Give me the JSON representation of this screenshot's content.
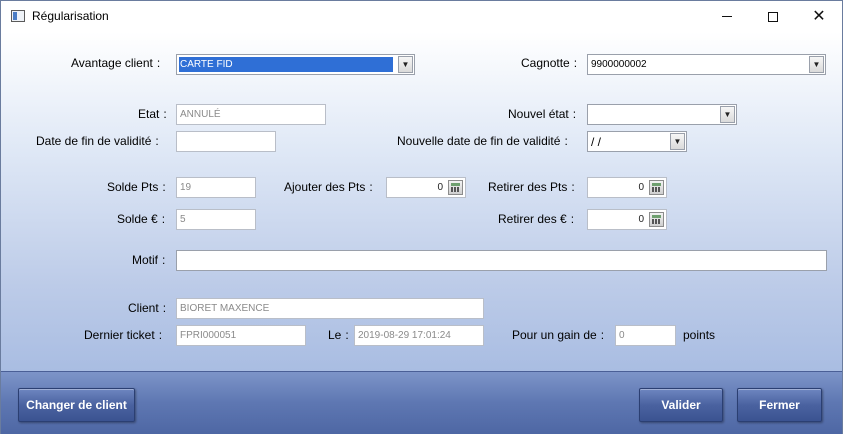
{
  "window": {
    "title": "Régularisation"
  },
  "labels": {
    "avantage": "Avantage client",
    "cagnotte": "Cagnotte",
    "etat": "Etat",
    "nouvel_etat": "Nouvel état",
    "date_fin": "Date de fin de validité",
    "nouvelle_date_fin": "Nouvelle date de fin de validité",
    "solde_pts": "Solde Pts",
    "ajouter_pts": "Ajouter des Pts",
    "retirer_pts": "Retirer des Pts",
    "solde_eur": "Solde €",
    "retirer_eur": "Retirer des €",
    "motif": "Motif",
    "client": "Client",
    "dernier_ticket": "Dernier ticket",
    "le": "Le",
    "gain": "Pour un gain de",
    "points": "points",
    "colon": ":"
  },
  "fields": {
    "avantage": "CARTE FID",
    "cagnotte": "9900000002",
    "etat": "ANNULÉ",
    "nouvel_etat": "",
    "date_fin": "",
    "nouvelle_date_fin": "/ /",
    "solde_pts": "19",
    "ajouter_pts": "0",
    "retirer_pts": "0",
    "solde_eur": "5",
    "retirer_eur": "0",
    "motif": "",
    "client": "BIORET MAXENCE",
    "dernier_ticket": "FPRI000051",
    "le": "2019-08-29 17:01:24",
    "gain": "0"
  },
  "buttons": {
    "change_client": "Changer de client",
    "valider": "Valider",
    "fermer": "Fermer"
  },
  "icons": {
    "dropdown": "▼",
    "close": "✕"
  }
}
